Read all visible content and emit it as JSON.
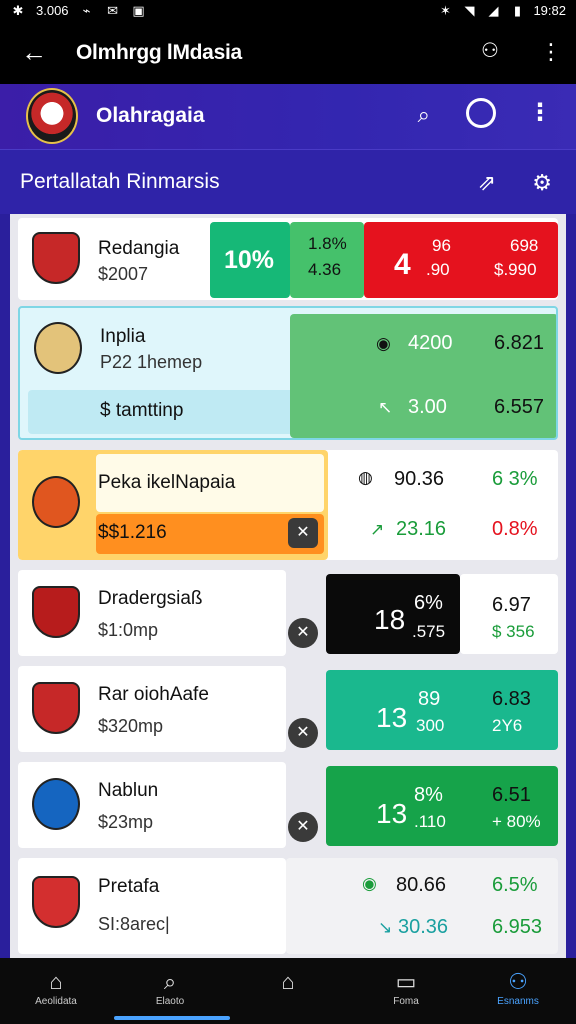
{
  "status": {
    "left_text": "3.006",
    "time": "19:82"
  },
  "appbar": {
    "title": "Olmhrgg lMdasia"
  },
  "club": {
    "name": "Olahragaia"
  },
  "section": {
    "title": "Pertallatah Rinmarsis"
  },
  "rows": [
    {
      "name": "Redangia",
      "sub": "$2007",
      "pct": "10%",
      "a1": "1.8%",
      "a2": "4.36",
      "big": "4",
      "big_sub": "96",
      "big_sub2": ".90",
      "r1": "698",
      "r2": "$.990"
    },
    {
      "name": "Inplia",
      "sub": "P22 1hemep",
      "input_value": "$ tamttinp",
      "c1": "4200",
      "c2": "6.821",
      "c3": "3.00",
      "c4": "6.557"
    },
    {
      "name": "Peka ikelNapaia",
      "sub": "$$1.216",
      "c1": "90.36",
      "c2": "6 3%",
      "c3": "23.16",
      "c4": "0.8%"
    },
    {
      "name": "Dradergsiaß",
      "sub": "$1:0mp",
      "big": "18",
      "big_a": "6%",
      "big_b": ".575",
      "c1": "6.97",
      "c2": "$ 356"
    },
    {
      "name": "Rar oiohAafe",
      "sub": "$320mp",
      "big": "13",
      "big_a": "89",
      "big_b": "300",
      "c1": "6.83",
      "c2": "2Y6"
    },
    {
      "name": "Nablun",
      "sub": "$23mp",
      "big": "13",
      "big_a": "8%",
      "big_b": ".110",
      "c1": "6.51",
      "c2": "+ 80%"
    },
    {
      "name": "Pretafa",
      "sub": "SI:8arec|",
      "c1": "80.66",
      "c2": "6.5%",
      "c3": "30.36",
      "c4": "6.953"
    }
  ],
  "nav": [
    {
      "label": "Aeolidata"
    },
    {
      "label": "Elaoto"
    },
    {
      "label": ""
    },
    {
      "label": "Foma"
    },
    {
      "label": "Esnanms"
    }
  ],
  "colors": {
    "green": "#16b877",
    "green2": "#45c16b",
    "red": "#e5121e",
    "teal": "#1ab88e",
    "orange": "#ff8f1f",
    "black": "#0a0a0a"
  }
}
